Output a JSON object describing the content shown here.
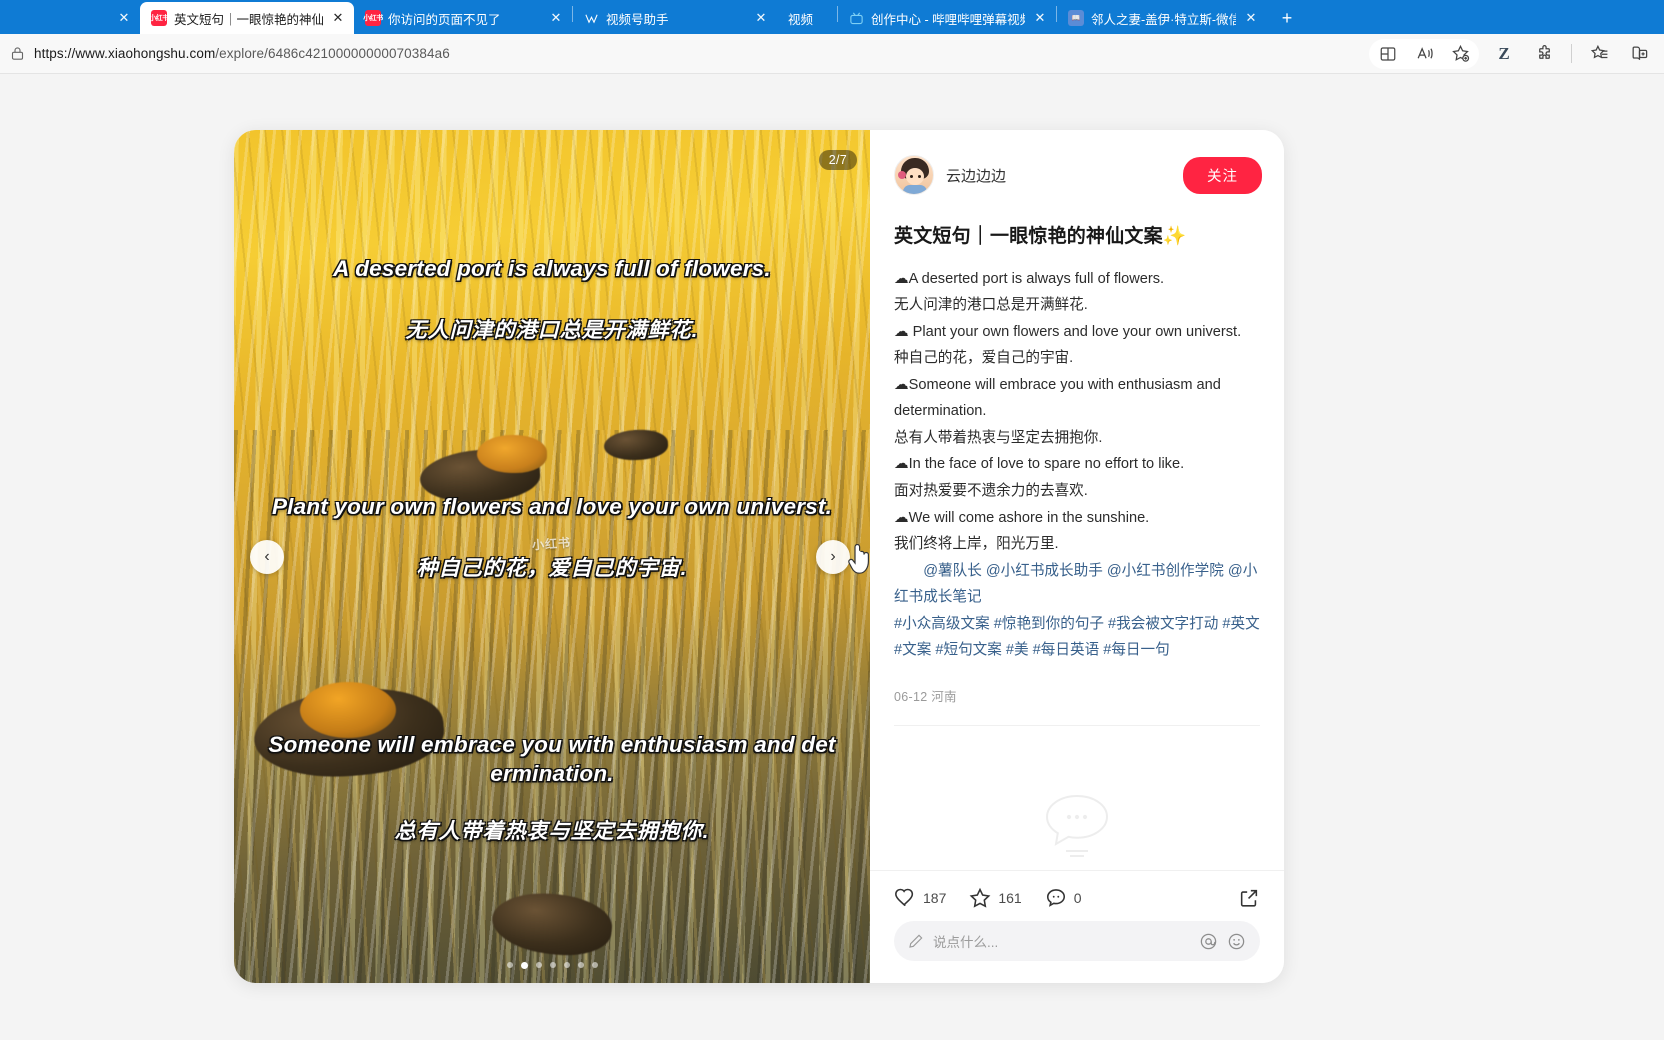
{
  "browser": {
    "tabs": [
      {
        "title": "",
        "favicon": "blank-icon",
        "active": false,
        "partial": true
      },
      {
        "title": "英文短句｜一眼惊艳的神仙文案✨",
        "favicon": "xiaohongshu-icon",
        "active": true
      },
      {
        "title": "你访问的页面不见了",
        "favicon": "xiaohongshu-icon",
        "active": false
      },
      {
        "title": "视频号助手",
        "favicon": "channels-icon",
        "active": false
      },
      {
        "title": "视频",
        "favicon": "blank-icon",
        "active": false
      },
      {
        "title": "创作中心 - 哔哩哔哩弹幕视频网",
        "favicon": "bilibili-icon",
        "active": false
      },
      {
        "title": "邻人之妻-盖伊·特立斯-微信读书",
        "favicon": "weread-icon",
        "active": false
      }
    ],
    "new_tab_label": "+",
    "close_label": "✕",
    "url_prefix": "https://www.xiaohongshu.com",
    "url_path": "/explore/6486c42100000000070384a6",
    "toolbar": [
      {
        "name": "split-screen-icon"
      },
      {
        "name": "read-aloud-icon"
      },
      {
        "name": "add-favorite-icon"
      },
      {
        "name": "zotero-connector-icon",
        "label": "Z"
      },
      {
        "name": "extensions-icon"
      },
      {
        "name": "favorites-icon"
      },
      {
        "name": "collections-icon"
      }
    ]
  },
  "note": {
    "author": "云边边边",
    "follow_label": "关注",
    "title": "英文短句｜一眼惊艳的神仙文案✨",
    "body_lines": [
      "☁A deserted port is always full of flowers.",
      "无人问津的港口总是开满鲜花.",
      "☁ Plant your own flowers and love your own universt.",
      "种自己的花，爱自己的宇宙.",
      "☁Someone will embrace you with enthusiasm and determination.",
      "总有人带着热衷与坚定去拥抱你.",
      "☁In the face of love to spare no effort to like.",
      "面对热爱要不遗余力的去喜欢.",
      "☁We will come ashore in the sunshine.",
      "我们终将上岸，阳光万里."
    ],
    "mentions": "　　@薯队长 @小红书成长助手 @小红书创作学院 @小红书成长笔记",
    "hashtags": "#小众高级文案 #惊艳到你的句子 #我会被文字打动 #英文 #文案 #短句文案 #美 #每日英语 #每日一句",
    "date_location": "06-12 河南",
    "likes": "187",
    "collects": "161",
    "comments": "0",
    "comment_placeholder": "说点什么...",
    "brand_color": "#ff2442"
  },
  "carousel": {
    "page_indicator": "2/7",
    "current": 2,
    "total": 7,
    "prev_label": "‹",
    "next_label": "›",
    "watermark": "小红书",
    "overlay_lines": [
      "A deserted port is always full of flowers.",
      "无人问津的港口总是开满鲜花.",
      "Plant your own flowers and love your own universt.",
      "种自己的花，爱自己的宇宙.",
      "Someone will embrace you with enthusiasm and det ermination.",
      "总有人带着热衷与坚定去拥抱你."
    ]
  }
}
